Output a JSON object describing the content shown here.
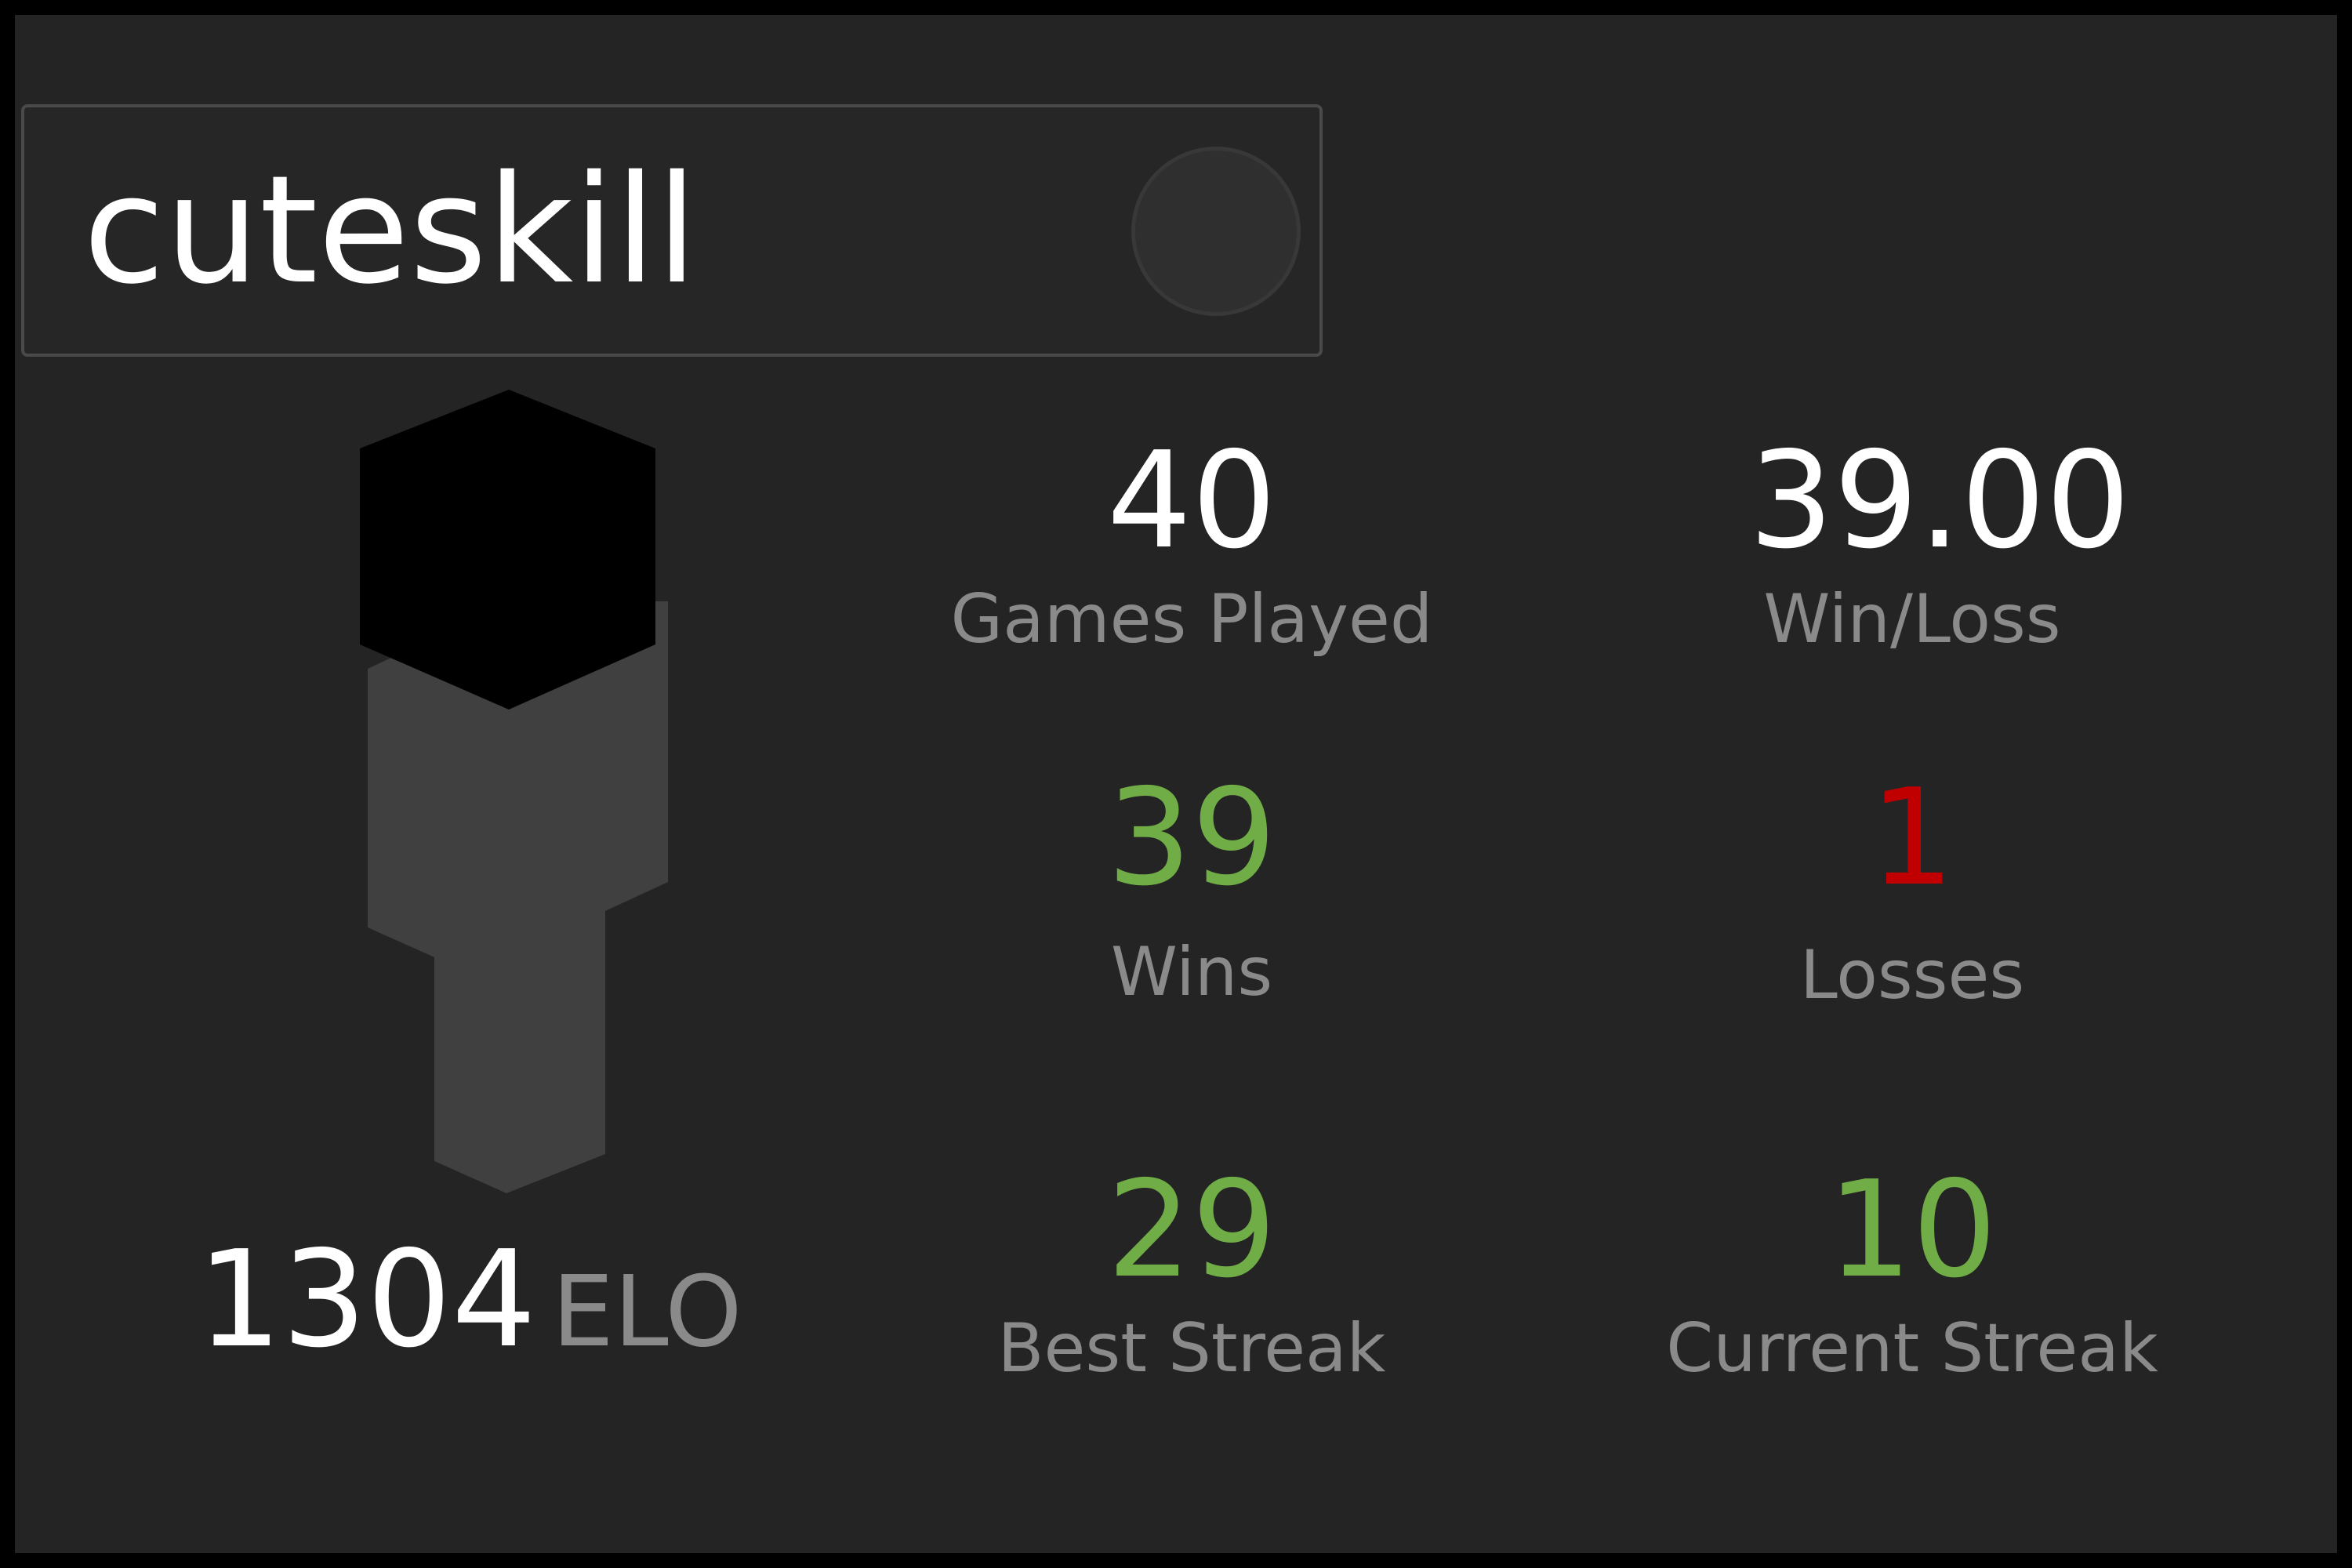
{
  "player": {
    "username": "cuteskill",
    "elo_value": "1304",
    "elo_unit": "ELO",
    "avatar_icon": "player-avatar-icon"
  },
  "stats": {
    "games_played": {
      "value": "40",
      "label": "Games Played"
    },
    "win_loss": {
      "value": "39.00",
      "label": "Win/Loss"
    },
    "wins": {
      "value": "39",
      "label": "Wins"
    },
    "losses": {
      "value": "1",
      "label": "Losses"
    },
    "best_streak": {
      "value": "29",
      "label": "Best Streak"
    },
    "current_streak": {
      "value": "10",
      "label": "Current Streak"
    }
  },
  "colors": {
    "background": "#242424",
    "positive": "#70ad47",
    "negative": "#c00000",
    "label": "#8a8a8a",
    "text": "#ffffff"
  }
}
